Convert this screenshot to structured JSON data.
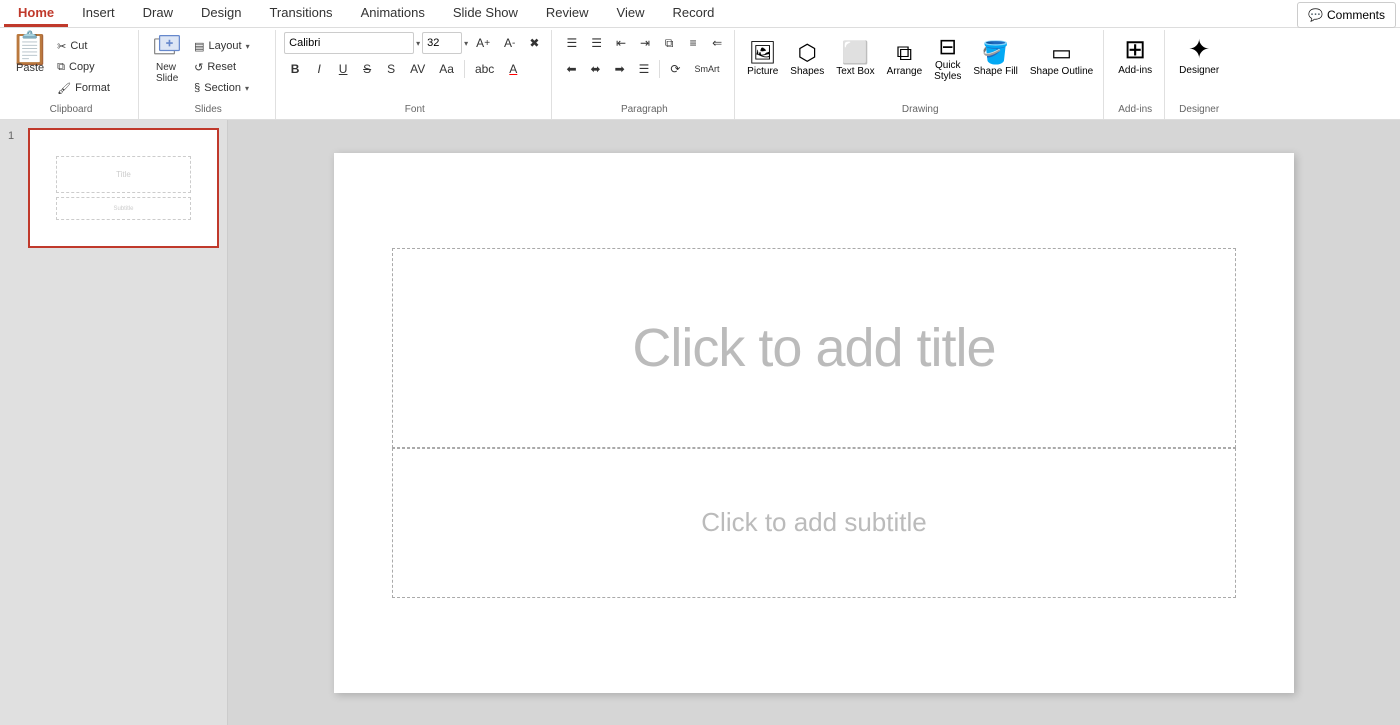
{
  "tabs": [
    {
      "label": "Home",
      "active": true
    },
    {
      "label": "Insert"
    },
    {
      "label": "Draw"
    },
    {
      "label": "Design"
    },
    {
      "label": "Transitions"
    },
    {
      "label": "Animations"
    },
    {
      "label": "Slide Show"
    },
    {
      "label": "Review"
    },
    {
      "label": "View"
    },
    {
      "label": "Record"
    }
  ],
  "comments_btn": "Comments",
  "ribbon": {
    "groups": [
      {
        "name": "clipboard",
        "label": "Clipboard",
        "buttons": [
          {
            "id": "paste",
            "label": "Paste",
            "icon": "📋",
            "size": "large"
          },
          {
            "id": "cut",
            "label": "Cut",
            "icon": "✂",
            "size": "small"
          },
          {
            "id": "copy",
            "label": "Copy",
            "icon": "⧉",
            "size": "small"
          },
          {
            "id": "format",
            "label": "Format",
            "icon": "🖌",
            "size": "small"
          }
        ]
      },
      {
        "name": "slides",
        "label": "Slides",
        "buttons": [
          {
            "id": "new-slide",
            "label": "New Slide",
            "icon": "⊞",
            "size": "large"
          },
          {
            "id": "layout",
            "label": "Layout",
            "icon": "▤",
            "size": "small"
          },
          {
            "id": "reset",
            "label": "Reset",
            "icon": "↺",
            "size": "small"
          },
          {
            "id": "section",
            "label": "Section",
            "icon": "§",
            "size": "small"
          }
        ]
      },
      {
        "name": "font",
        "label": "Font",
        "font_name": "Calibri",
        "font_size": "32",
        "format_buttons": [
          {
            "id": "bold",
            "label": "B",
            "title": "Bold"
          },
          {
            "id": "italic",
            "label": "I",
            "title": "Italic"
          },
          {
            "id": "underline",
            "label": "U",
            "title": "Underline"
          },
          {
            "id": "strikethrough",
            "label": "S̶",
            "title": "Strikethrough"
          },
          {
            "id": "shadow",
            "label": "S",
            "title": "Shadow"
          }
        ]
      },
      {
        "name": "paragraph",
        "label": "Paragraph",
        "buttons": []
      },
      {
        "name": "drawing",
        "label": "Drawing",
        "buttons": [
          {
            "id": "picture",
            "label": "Picture",
            "icon": "🖼"
          },
          {
            "id": "shapes",
            "label": "Shapes",
            "icon": "⬡"
          },
          {
            "id": "text-box",
            "label": "Text Box",
            "icon": "⬜"
          },
          {
            "id": "arrange",
            "label": "Arrange",
            "icon": "⧉"
          },
          {
            "id": "quick-styles",
            "label": "Quick Styles",
            "icon": "⊟"
          },
          {
            "id": "shape-fill",
            "label": "Shape Fill",
            "icon": "🪣"
          },
          {
            "id": "shape-outline",
            "label": "Shape Outline",
            "icon": "▭"
          },
          {
            "id": "convert-smartart",
            "label": "Convert to SmartArt",
            "icon": "⟳"
          }
        ]
      },
      {
        "name": "add-ins",
        "label": "Add-ins",
        "buttons": [
          {
            "id": "add-ins",
            "label": "Add-ins",
            "icon": "⊞"
          }
        ]
      },
      {
        "name": "designer",
        "label": "Designer",
        "buttons": [
          {
            "id": "designer",
            "label": "Designer",
            "icon": "✦"
          }
        ]
      }
    ]
  },
  "slide": {
    "number": 1,
    "title_placeholder": "Click to add title",
    "subtitle_placeholder": "Click to add subtitle"
  }
}
